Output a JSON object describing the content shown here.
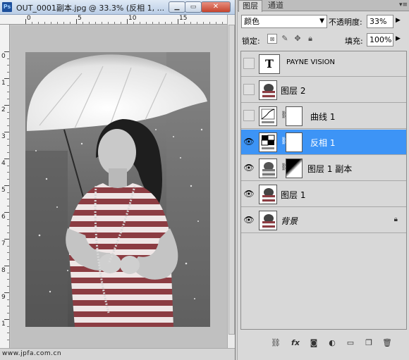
{
  "document": {
    "app_icon": "Ps",
    "title": "OUT_0001副本.jpg @ 33.3% (反相 1, ...",
    "min_icon": "minimize-icon",
    "max_icon": "maximize-icon",
    "close_icon": "close-icon",
    "watermark": "www.jpfa.com.cn",
    "ruler_h_labels": [
      "0",
      "5",
      "10",
      "15"
    ],
    "ruler_v_labels": [
      "0",
      "1",
      "2",
      "3",
      "4",
      "5",
      "6",
      "7",
      "8",
      "9",
      "1"
    ]
  },
  "panel": {
    "tabs": [
      "图层",
      "通道"
    ],
    "blend_mode": "颜色",
    "opacity_label": "不透明度:",
    "opacity_value": "33%",
    "lock_label": "锁定:",
    "fill_label": "填充:",
    "fill_value": "100%",
    "layers": [
      {
        "name": "PAYNE VISION",
        "type": "text",
        "visible": false,
        "selected": false
      },
      {
        "name": "图层 2",
        "type": "image",
        "visible": false,
        "selected": false
      },
      {
        "name": "曲线 1",
        "type": "curves",
        "visible": false,
        "selected": false
      },
      {
        "name": "反相 1",
        "type": "invert",
        "visible": true,
        "selected": true
      },
      {
        "name": "图层 1 副本",
        "type": "image-mask",
        "visible": true,
        "selected": false
      },
      {
        "name": "图层 1",
        "type": "image",
        "visible": true,
        "selected": false
      },
      {
        "name": "背景",
        "type": "background",
        "visible": true,
        "selected": false,
        "locked": true
      }
    ],
    "bottom_icons": [
      "link-icon",
      "fx-icon",
      "mask-icon",
      "adjustment-icon",
      "group-icon",
      "new-layer-icon",
      "trash-icon"
    ]
  },
  "colors": {
    "selection": "#3d94f6",
    "panel_bg": "#d9d9d9",
    "close_button": "#c5442d"
  }
}
